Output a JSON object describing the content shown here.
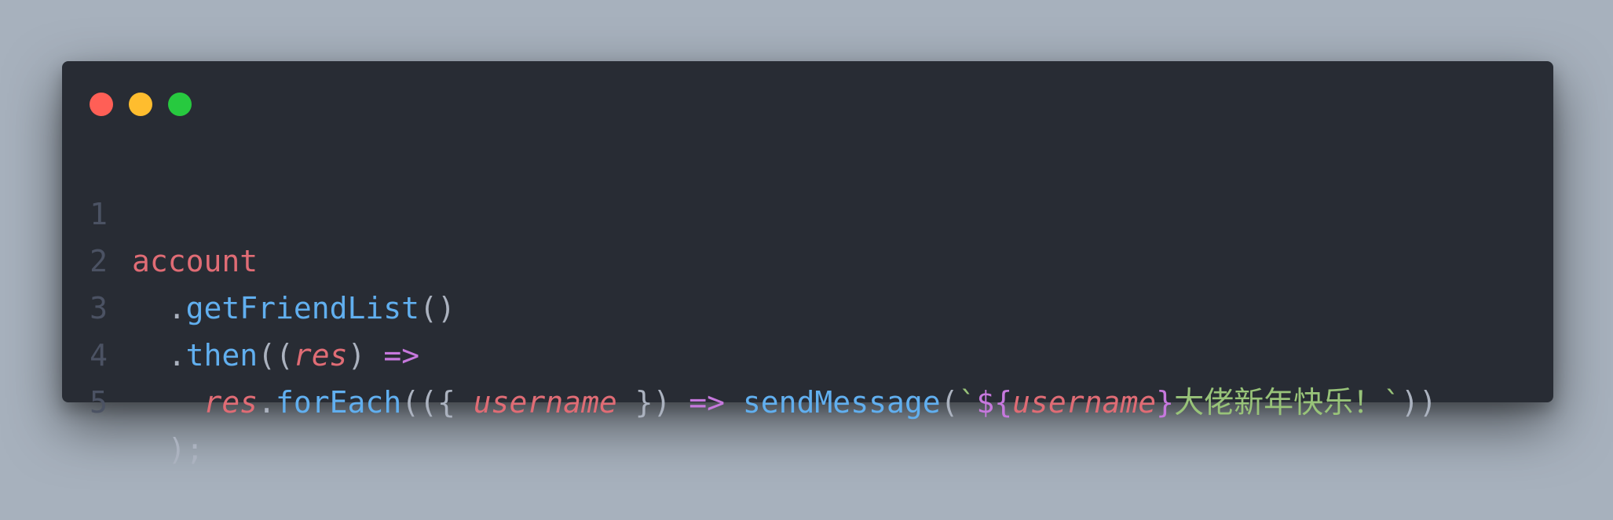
{
  "window": {
    "controls": [
      "close",
      "minimize",
      "maximize"
    ],
    "colors": {
      "background": "#282c34",
      "close": "#ff5f56",
      "minimize": "#ffbd2e",
      "maximize": "#27c93f"
    }
  },
  "syntax_colors": {
    "variable": "#e06c75",
    "function": "#61afef",
    "operator": "#c678dd",
    "string": "#98c379",
    "punctuation": "#abb2bf",
    "line_number": "#4b5263"
  },
  "code": {
    "lines": [
      {
        "number": "1",
        "tokens": [
          "account"
        ]
      },
      {
        "number": "2",
        "tokens": [
          "  .",
          "getFriendList",
          "()"
        ]
      },
      {
        "number": "3",
        "tokens": [
          "  .",
          "then",
          "((",
          "res",
          ") ",
          "=>"
        ]
      },
      {
        "number": "4",
        "tokens": [
          "    ",
          "res",
          ".",
          "forEach",
          "(({ ",
          "username",
          " }) ",
          "=>",
          " ",
          "sendMessage",
          "(",
          "`",
          "${",
          "username",
          "}",
          "大佬新年快乐！",
          "`",
          "))"
        ]
      },
      {
        "number": "5",
        "tokens": [
          "  );"
        ]
      }
    ]
  }
}
